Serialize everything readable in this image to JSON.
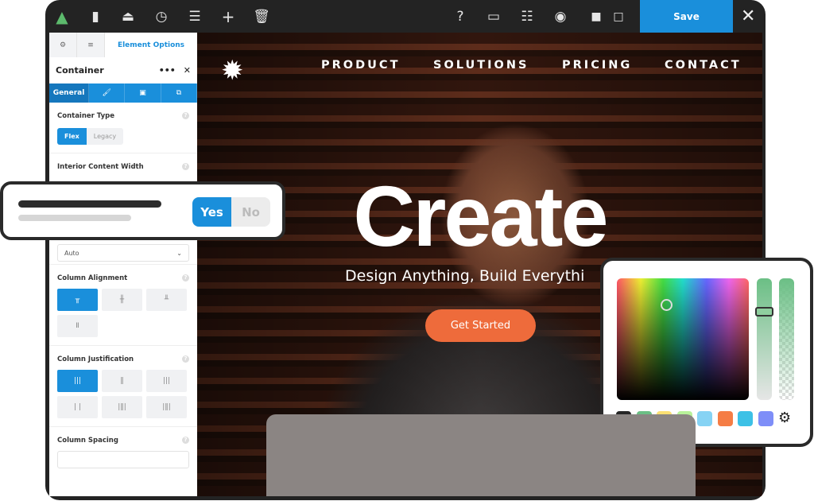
{
  "toolbar": {
    "icons": [
      "logo-icon",
      "layout-icon",
      "drive-icon",
      "history-icon",
      "toggles-icon",
      "add-icon",
      "trash-icon",
      "help-icon",
      "desktop-icon",
      "layers-icon",
      "preview-icon",
      "page-filled-icon",
      "page-outline-icon"
    ],
    "save_label": "Save",
    "accent": "#1a8fdb"
  },
  "sidebar": {
    "tabs": {
      "active": "Element Options"
    },
    "title": "Container",
    "sub_tabs": {
      "general": "General"
    },
    "container_type": {
      "label": "Container Type",
      "options": [
        "Flex",
        "Legacy"
      ],
      "selected": "Flex"
    },
    "interior_width": {
      "label": "Interior Content Width",
      "value": "Auto"
    },
    "column_alignment": {
      "label": "Column Alignment"
    },
    "column_justification": {
      "label": "Column Justification"
    },
    "column_spacing": {
      "label": "Column Spacing",
      "value": ""
    }
  },
  "canvas": {
    "nav": [
      "PRODUCT",
      "SOLUTIONS",
      "PRICING",
      "CONTACT"
    ],
    "headline": "Create",
    "subheadline": "Design Anything, Build Everythi",
    "cta": "Get Started",
    "cta_color": "#ee6b3b"
  },
  "toggle": {
    "yes": "Yes",
    "no": "No",
    "selected": "Yes"
  },
  "picker": {
    "swatches": [
      "#262626",
      "#6bbf85",
      "#fde073",
      "#b8f29a",
      "#86d3f4",
      "#f57d45",
      "#3cc1e6",
      "#7e8ef8"
    ]
  }
}
